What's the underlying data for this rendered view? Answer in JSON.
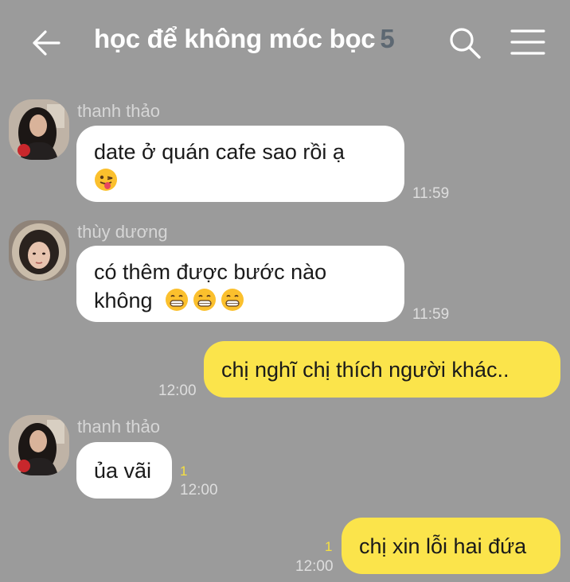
{
  "header": {
    "title": "học để không móc bọc",
    "member_count": "5",
    "icons": {
      "back": "arrow-left-icon",
      "search": "search-icon",
      "menu": "hamburger-menu-icon"
    }
  },
  "colors": {
    "background": "#9b9b9b",
    "incoming_bubble": "#ffffff",
    "outgoing_bubble": "#fbe44b",
    "unread": "#f6e03f"
  },
  "messages": [
    {
      "sender": "thanh thảo",
      "line1": "date ở quán cafe sao rồi ạ",
      "time": "11:59",
      "emoji": "face-with-tongue-winking"
    },
    {
      "sender": "thùy dương",
      "line1": "có thêm được bước nào",
      "line2": "không",
      "time": "11:59",
      "emoji": "grinning-face-x3"
    },
    {
      "text": "chị nghĩ chị thích người khác..",
      "time": "12:00"
    },
    {
      "sender": "thanh thảo",
      "text": "ủa vãi",
      "unread": "1",
      "time": "12:00"
    },
    {
      "text": "chị xin lỗi hai đứa",
      "unread": "1",
      "time": "12:00"
    }
  ]
}
